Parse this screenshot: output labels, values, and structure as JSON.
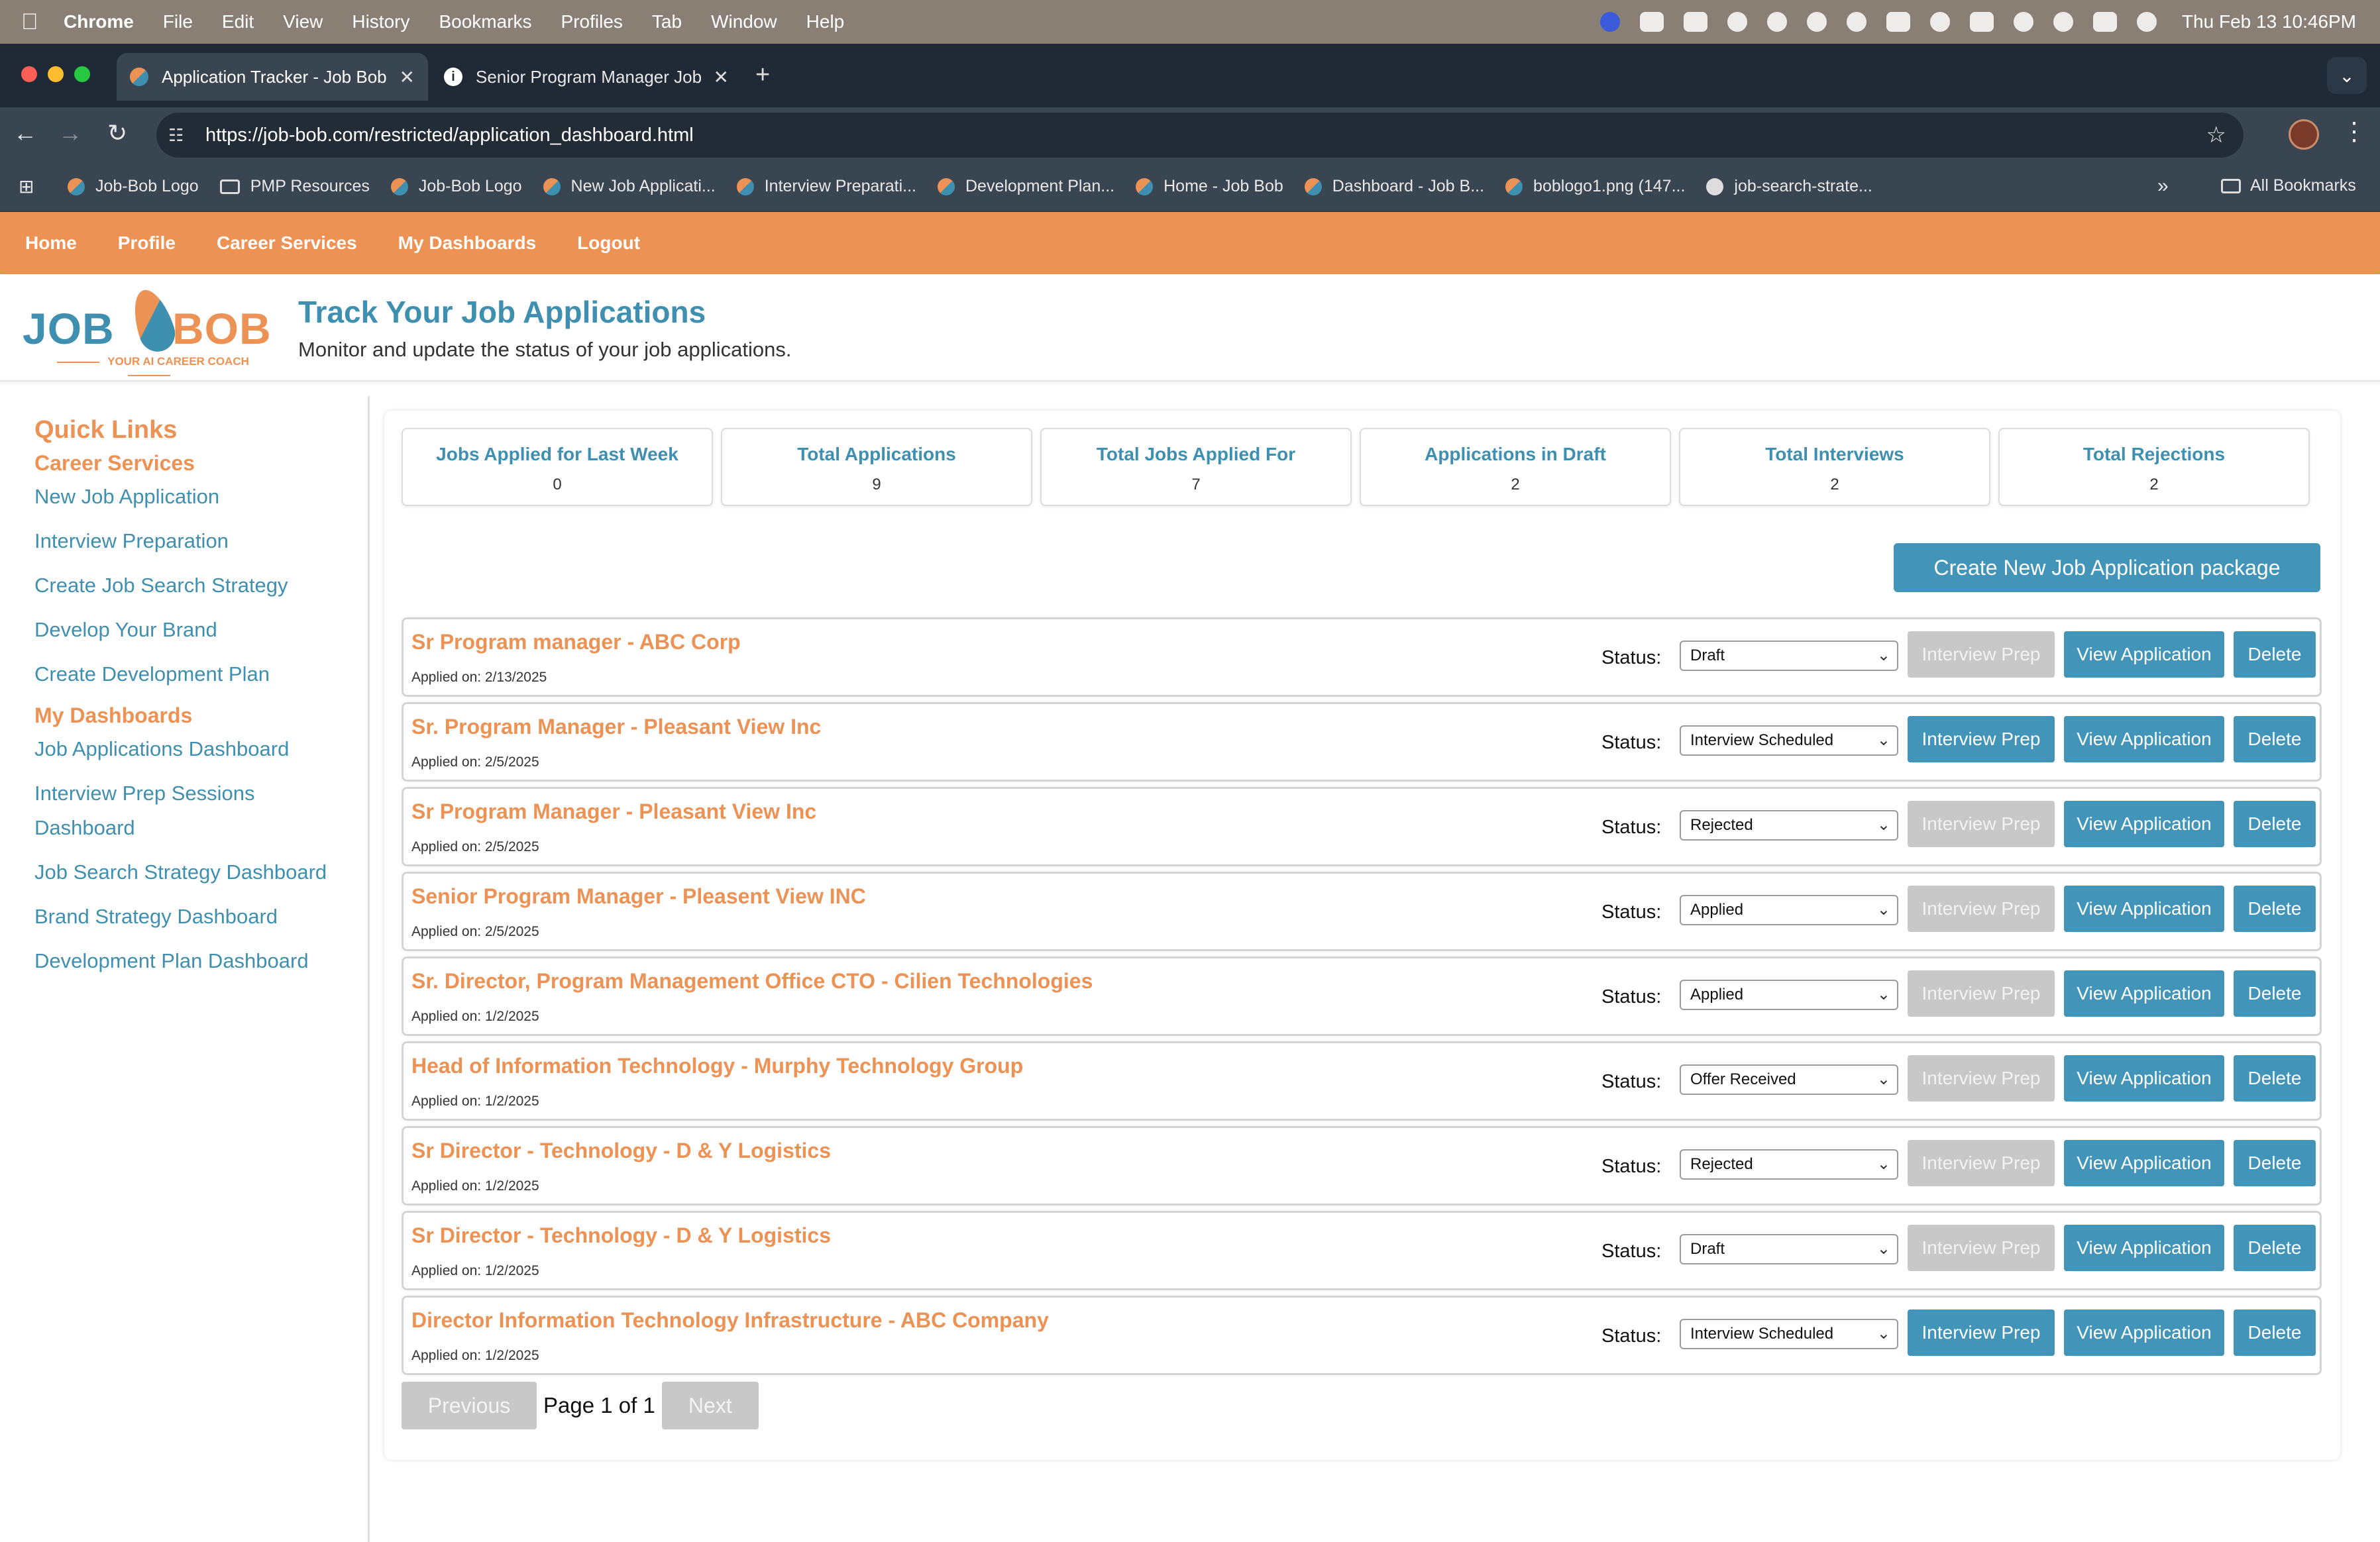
{
  "menubar": {
    "items": [
      "Chrome",
      "File",
      "Edit",
      "View",
      "History",
      "Bookmarks",
      "Profiles",
      "Tab",
      "Window",
      "Help"
    ],
    "clock": "Thu Feb 13  10:46PM"
  },
  "tabs": [
    {
      "title": "Application Tracker - Job Bob"
    },
    {
      "title": "Senior Program Manager Job"
    }
  ],
  "address": {
    "url": "https://job-bob.com/restricted/application_dashboard.html"
  },
  "bookmarks": {
    "items": [
      "Job-Bob Logo",
      "PMP Resources",
      "Job-Bob Logo",
      "New Job Applicati...",
      "Interview Preparati...",
      "Development Plan...",
      "Home - Job Bob",
      "Dashboard - Job B...",
      "boblogo1.png (147...",
      "job-search-strate..."
    ],
    "all": "All Bookmarks"
  },
  "sitenav": [
    "Home",
    "Profile",
    "Career Services",
    "My Dashboards",
    "Logout"
  ],
  "header": {
    "logo_left": "JOB",
    "logo_right": "BOB",
    "logo_tag": "YOUR AI CAREER COACH",
    "title": "Track Your Job Applications",
    "subtitle": "Monitor and update the status of your job applications."
  },
  "sidebar": {
    "title": "Quick Links",
    "section1": "Career Services",
    "links1": [
      "New Job Application",
      "Interview Preparation",
      "Create Job Search Strategy",
      "Develop Your Brand",
      "Create Development Plan"
    ],
    "section2": "My Dashboards",
    "links2": [
      "Job Applications Dashboard",
      "Interview Prep Sessions Dashboard",
      "Job Search Strategy Dashboard",
      "Brand Strategy Dashboard",
      "Development Plan Dashboard"
    ]
  },
  "stats": [
    {
      "label": "Jobs Applied for Last Week",
      "value": "0"
    },
    {
      "label": "Total Applications",
      "value": "9"
    },
    {
      "label": "Total Jobs Applied For",
      "value": "7"
    },
    {
      "label": "Applications in Draft",
      "value": "2"
    },
    {
      "label": "Total Interviews",
      "value": "2"
    },
    {
      "label": "Total Rejections",
      "value": "2"
    }
  ],
  "create_button": "Create New Job Application package",
  "row_labels": {
    "status": "Status:",
    "interview_prep": "Interview Prep",
    "view": "View Application",
    "delete": "Delete"
  },
  "applications": [
    {
      "title": "Sr Program manager - ABC Corp",
      "applied": "Applied on: 2/13/2025",
      "status": "Draft",
      "interview_enabled": false
    },
    {
      "title": "Sr. Program Manager - Pleasant View Inc",
      "applied": "Applied on: 2/5/2025",
      "status": "Interview Scheduled",
      "interview_enabled": true
    },
    {
      "title": "Sr Program Manager - Pleasant View Inc",
      "applied": "Applied on: 2/5/2025",
      "status": "Rejected",
      "interview_enabled": false
    },
    {
      "title": "Senior Program Manager - Pleasent View INC",
      "applied": "Applied on: 2/5/2025",
      "status": "Applied",
      "interview_enabled": false
    },
    {
      "title": "Sr. Director, Program Management Office CTO - Cilien Technologies",
      "applied": "Applied on: 1/2/2025",
      "status": "Applied",
      "interview_enabled": false
    },
    {
      "title": "Head of Information Technology - Murphy Technology Group",
      "applied": "Applied on: 1/2/2025",
      "status": "Offer Received",
      "interview_enabled": false
    },
    {
      "title": "Sr Director - Technology - D & Y Logistics",
      "applied": "Applied on: 1/2/2025",
      "status": "Rejected",
      "interview_enabled": false
    },
    {
      "title": "Sr Director - Technology - D & Y Logistics",
      "applied": "Applied on: 1/2/2025",
      "status": "Draft",
      "interview_enabled": false
    },
    {
      "title": "Director Information Technology Infrastructure - ABC Company",
      "applied": "Applied on: 1/2/2025",
      "status": "Interview Scheduled",
      "interview_enabled": true
    }
  ],
  "pagination": {
    "previous": "Previous",
    "page_text": "Page 1 of 1",
    "next": "Next"
  },
  "colors": {
    "brand_orange": "#ec9254",
    "brand_blue": "#3f8fb0",
    "button_blue": "#4295b8",
    "disabled_gray": "#c8c8c8"
  }
}
